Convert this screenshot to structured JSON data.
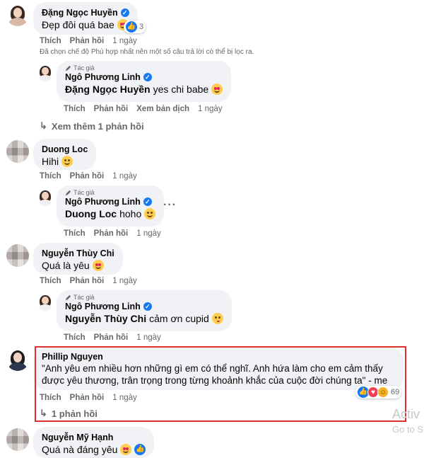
{
  "comments": [
    {
      "author": "Đặng Ngọc Huyền",
      "verified": true,
      "text": "Đẹp đôi quá bae",
      "reactions": "3",
      "actions": [
        "Thích",
        "Phản hồi"
      ],
      "time": "1 ngày"
    },
    {
      "author": "Duong Loc",
      "text": "Hihi",
      "actions": [
        "Thích",
        "Phản hồi"
      ],
      "time": "1 ngày"
    },
    {
      "author": "Nguyễn Thùy Chi",
      "text": "Quá là yêu",
      "actions": [
        "Thích",
        "Phản hồi"
      ],
      "time": "1 ngày"
    },
    {
      "author": "Phillip Nguyen",
      "text_line1": "\"Anh yêu em nhiều hơn những gì em có thể nghĩ. Anh hứa làm cho em cảm thấy",
      "text_line2": "được yêu thương, trân trọng trong từng khoảnh khắc của cuộc đời chúng ta\" - me",
      "reactions": "69",
      "actions": [
        "Thích",
        "Phản hồi"
      ],
      "time": "1 ngày",
      "more_replies": "1 phản hồi"
    },
    {
      "author": "Nguyễn Mỹ Hạnh",
      "text": "Quá nà đáng yêu"
    }
  ],
  "filter_notice": "Đã chọn chế độ Phù hợp nhất nên một số câu trả lời có thể bị lọc ra.",
  "replies": [
    {
      "tag": "Tác giả",
      "author": "Ngô Phương Linh",
      "mention": "Đặng Ngọc Huyền",
      "text": "yes chi babe",
      "actions": [
        "Thích",
        "Phản hồi",
        "Xem bản dịch"
      ],
      "time": "1 ngày"
    },
    {
      "tag": "Tác giả",
      "author": "Ngô Phương Linh",
      "mention": "Duong Loc",
      "text": "hoho",
      "actions": [
        "Thích",
        "Phản hồi"
      ],
      "time": "1 ngày"
    },
    {
      "tag": "Tác giả",
      "author": "Ngô Phương Linh",
      "mention": "Nguyễn Thùy Chi",
      "text": "cảm ơn cupid",
      "actions": [
        "Thích",
        "Phản hồi"
      ],
      "time": "1 ngày"
    }
  ],
  "more_replies_1": "Xem thêm 1 phản hồi",
  "watermark": {
    "line1": "Activ",
    "line2": "Go to S"
  },
  "colors": {
    "bubble": "#f0f2f5",
    "secondary_text": "#65676b",
    "highlight_border": "#e0302e",
    "facebook_blue": "#1877f2"
  }
}
